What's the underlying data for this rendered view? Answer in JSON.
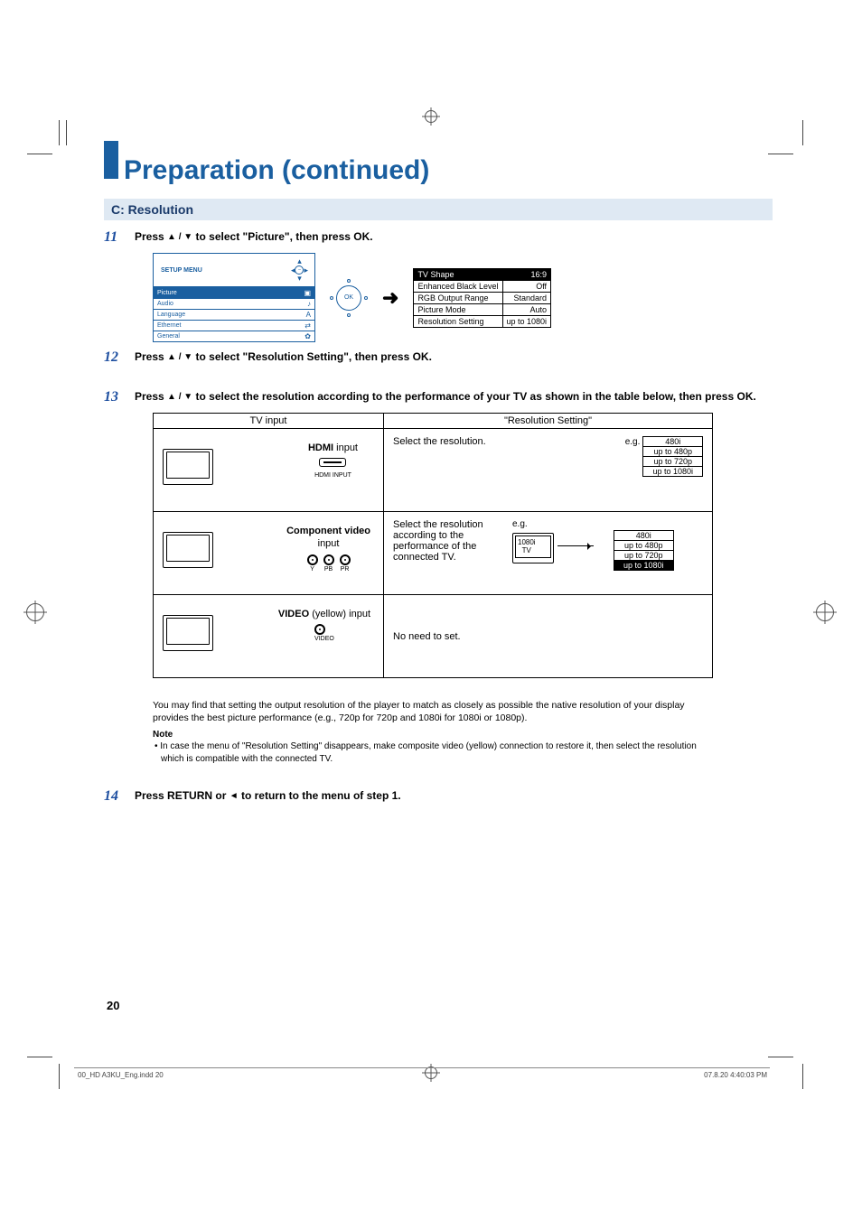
{
  "title": "Preparation (continued)",
  "subsection": "C: Resolution",
  "steps": {
    "s11": {
      "num": "11",
      "pre": "Press ",
      "mid": " to select \"Picture\", then press OK."
    },
    "s12": {
      "num": "12",
      "pre": "Press ",
      "mid": " to select \"Resolution Setting\", then press OK."
    },
    "s13": {
      "num": "13",
      "pre": "Press ",
      "mid": " to select the resolution according to the performance of your TV as shown in the table below, then press OK."
    },
    "s14": {
      "num": "14",
      "pre": "Press RETURN or ",
      "mid": " to return to the menu of step 1."
    }
  },
  "arrows": {
    "updown": "▲ / ▼",
    "left": "◄"
  },
  "setupMenu": {
    "label": "SETUP MENU",
    "okLabel": "OK",
    "items": [
      {
        "name": "Picture",
        "icon": "▣"
      },
      {
        "name": "Audio",
        "icon": "♪"
      },
      {
        "name": "Language",
        "icon": "A"
      },
      {
        "name": "Ethernet",
        "icon": "⇄"
      },
      {
        "name": "General",
        "icon": "✿"
      }
    ]
  },
  "pictureSettings": [
    {
      "name": "TV Shape",
      "value": "16:9"
    },
    {
      "name": "Enhanced Black Level",
      "value": "Off"
    },
    {
      "name": "RGB Output Range",
      "value": "Standard"
    },
    {
      "name": "Picture Mode",
      "value": "Auto"
    },
    {
      "name": "Resolution Setting",
      "value": "up to 1080i"
    }
  ],
  "bigTable": {
    "headers": [
      "TV input",
      "\"Resolution Setting\""
    ],
    "rows": [
      {
        "inputTitle": "HDMI",
        "inputSuffix": " input",
        "sub": "HDMI INPUT",
        "resText": "Select the resolution.",
        "eg": "e.g.",
        "opts": [
          "480i",
          "up to 480p",
          "up to 720p",
          "up to 1080i"
        ]
      },
      {
        "inputTitle": "Component video",
        "inputSuffix": "\ninput",
        "jacks": [
          "Y",
          "PB",
          "PR"
        ],
        "resText": "Select the resolution according to the performance of the connected TV.",
        "eg": "e.g.",
        "tvLabel": "1080i\nTV",
        "opts": [
          "480i",
          "up to 480p",
          "up to 720p",
          "up to 1080i"
        ]
      },
      {
        "inputTitle": "VIDEO",
        "inputSuffix": " (yellow) input",
        "jacks": [
          "VIDEO"
        ],
        "resText": "No need to set."
      }
    ]
  },
  "advice": "You may find that setting the output resolution of the player to match as closely as possible the native resolution of your display provides the best picture performance (e.g., 720p for 720p and 1080i for 1080i or 1080p).",
  "noteLabel": "Note",
  "noteBody": "• In case the menu of \"Resolution Setting\" disappears, make composite video (yellow) connection to restore it, then select the resolution which is compatible with the connected TV.",
  "pageNum": "20",
  "footer": {
    "left": "00_HD A3KU_Eng.indd   20",
    "right": "07.8.20   4:40:03 PM"
  }
}
